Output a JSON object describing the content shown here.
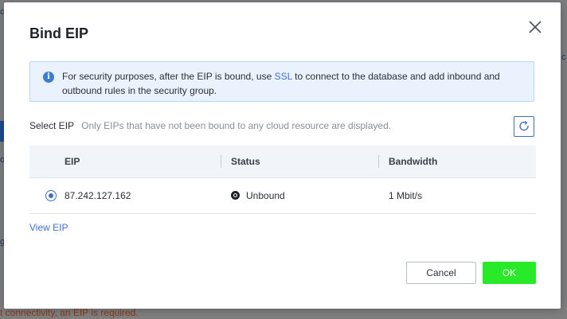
{
  "background": {
    "bottom_text": "t connectivity, an EIP is required.",
    "fragments": [
      "c",
      "o",
      "c",
      "g"
    ]
  },
  "dialog": {
    "title": "Bind EIP",
    "alert": {
      "text_before": "For security purposes, after the EIP is bound, use ",
      "link": "SSL",
      "text_after": " to connect to the database and add inbound and outbound rules in the security group."
    },
    "select_label": "Select EIP",
    "select_hint": "Only EIPs that have not been bound to any cloud resource are displayed.",
    "table": {
      "columns": [
        "EIP",
        "Status",
        "Bandwidth"
      ],
      "rows": [
        {
          "eip": "87.242.127.162",
          "status": "Unbound",
          "bandwidth": "1 Mbit/s",
          "selected": true
        }
      ]
    },
    "view_link": "View EIP",
    "cancel_label": "Cancel",
    "ok_label": "OK"
  },
  "colors": {
    "accent": "#3f6fbf",
    "link": "#3e6fd8",
    "ok_button": "#28ea28",
    "alert_bg": "#eaf3fd"
  }
}
